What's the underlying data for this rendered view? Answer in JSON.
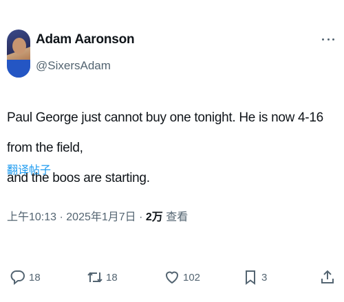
{
  "author": {
    "display_name": "Adam Aaronson",
    "handle": "@SixersAdam"
  },
  "more_icon": "more-horizontal-icon",
  "tweet": {
    "text_line1": "Paul George just cannot buy one tonight. He is now 4-16 from the field,",
    "text_line2": "and the boos are starting.",
    "translate_label": "翻译帖子"
  },
  "meta": {
    "time": "上午10:13",
    "sep1": " · ",
    "date": "2025年1月7日",
    "sep2": " · ",
    "views_count": "2万",
    "views_label": " 查看"
  },
  "actions": {
    "reply": {
      "icon": "reply-icon",
      "count": "18"
    },
    "retweet": {
      "icon": "retweet-icon",
      "count": "18"
    },
    "like": {
      "icon": "heart-icon",
      "count": "102"
    },
    "bookmark": {
      "icon": "bookmark-icon",
      "count": "3"
    },
    "share": {
      "icon": "share-icon"
    }
  },
  "colors": {
    "text": "#0f1419",
    "secondary": "#536471",
    "link": "#1d9bf0"
  }
}
